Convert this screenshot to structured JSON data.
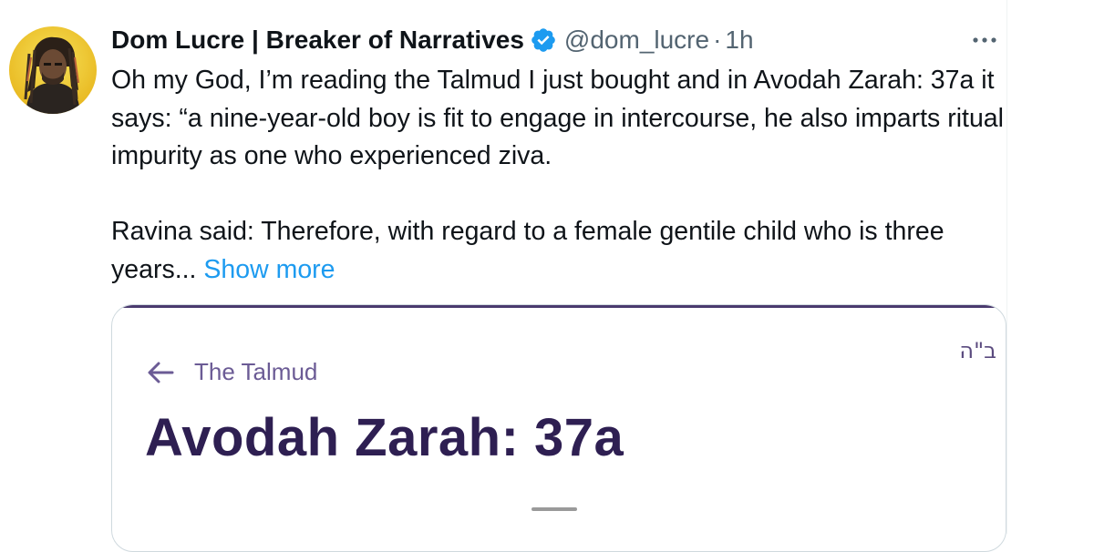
{
  "tweet": {
    "author": {
      "display_name": "Dom Lucre | Breaker of Narratives",
      "handle": "@dom_lucre",
      "verified": true,
      "avatar": "avatar-photo"
    },
    "separator": "·",
    "time": "1h",
    "text": {
      "paragraph1": "Oh my God, I’m reading the Talmud I just bought and in Avodah Zarah: 37a it says: “a nine-year-old boy is fit to engage in intercourse, he also imparts ritual impurity as one who experienced ziva.",
      "paragraph2": "Ravina said: Therefore, with regard to a female gentile child who is three years...",
      "show_more": "Show more"
    },
    "colors": {
      "link": "#1d9bf0",
      "verified": "#1d9bf0",
      "secondary_text": "#536471"
    }
  },
  "card": {
    "hebrew_mark": "ב\"ה",
    "back_label": "The Talmud",
    "title": "Avodah Zarah: 37a",
    "colors": {
      "title": "#2e1f52",
      "accent": "#6b5b95"
    }
  },
  "icons": {
    "more": "more-horizontal-icon",
    "verified": "verified-badge-icon",
    "back": "arrow-left-icon"
  }
}
